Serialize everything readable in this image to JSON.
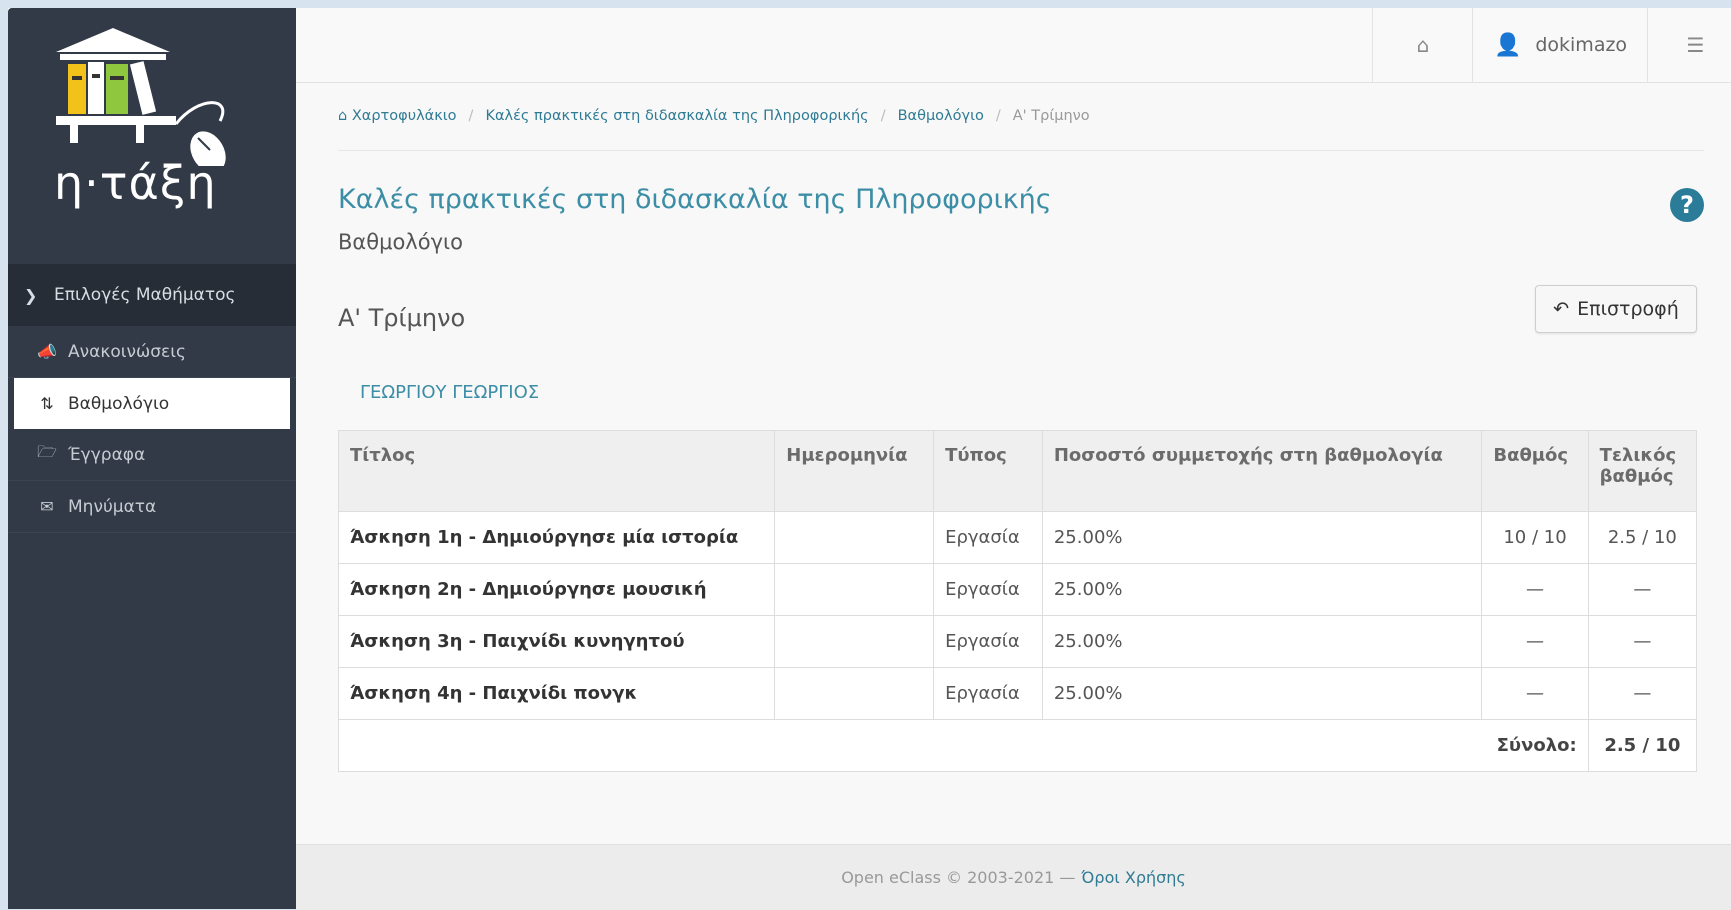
{
  "logo": {
    "text": "η·τάξη"
  },
  "sidebar": {
    "header": "Επιλογές Μαθήματος",
    "items": [
      {
        "label": "Ανακοινώσεις",
        "icon": "megaphone-icon"
      },
      {
        "label": "Βαθμολόγιο",
        "icon": "sort-icon",
        "active": true
      },
      {
        "label": "Έγγραφα",
        "icon": "folder-open-icon"
      },
      {
        "label": "Μηνύματα",
        "icon": "envelope-icon"
      }
    ]
  },
  "topbar": {
    "username": "dokimazo"
  },
  "breadcrumb": {
    "portfolio": "Χαρτοφυλάκιο",
    "course": "Καλές πρακτικές στη διδασκαλία της Πληροφορικής",
    "gradebook": "Βαθμολόγιο",
    "current": "Α' Τρίμηνο"
  },
  "course": {
    "title": "Καλές πρακτικές στη διδασκαλία της Πληροφορικής",
    "subtitle": "Βαθμολόγιο"
  },
  "section": {
    "title": "Α' Τρίμηνο",
    "back_label": "Επιστροφή",
    "student": "ΓΕΩΡΓΙΟΥ ΓΕΩΡΓΙΟΣ"
  },
  "table": {
    "headers": [
      "Τίτλος",
      "Ημερομηνία",
      "Τύπος",
      "Ποσοστό συμμετοχής στη βαθμολογία",
      "Βαθμός",
      "Τελικός βαθμός"
    ],
    "rows": [
      {
        "title": "Άσκηση 1η - Δημιούργησε μία ιστορία",
        "date": "",
        "type": "Εργασία",
        "percent": "25.00%",
        "grade": "10 / 10",
        "final": "2.5 / 10"
      },
      {
        "title": "Άσκηση 2η - Δημιούργησε μουσική",
        "date": "",
        "type": "Εργασία",
        "percent": "25.00%",
        "grade": "—",
        "final": "—"
      },
      {
        "title": "Άσκηση 3η - Παιχνίδι κυνηγητού",
        "date": "",
        "type": "Εργασία",
        "percent": "25.00%",
        "grade": "—",
        "final": "—"
      },
      {
        "title": "Άσκηση 4η - Παιχνίδι πονγκ",
        "date": "",
        "type": "Εργασία",
        "percent": "25.00%",
        "grade": "—",
        "final": "—"
      }
    ],
    "total_label": "Σύνολο:",
    "total_value": "2.5 / 10"
  },
  "footer": {
    "copyright": "Open eClass © 2003-2021 —",
    "terms": "Όροι Χρήσης"
  }
}
